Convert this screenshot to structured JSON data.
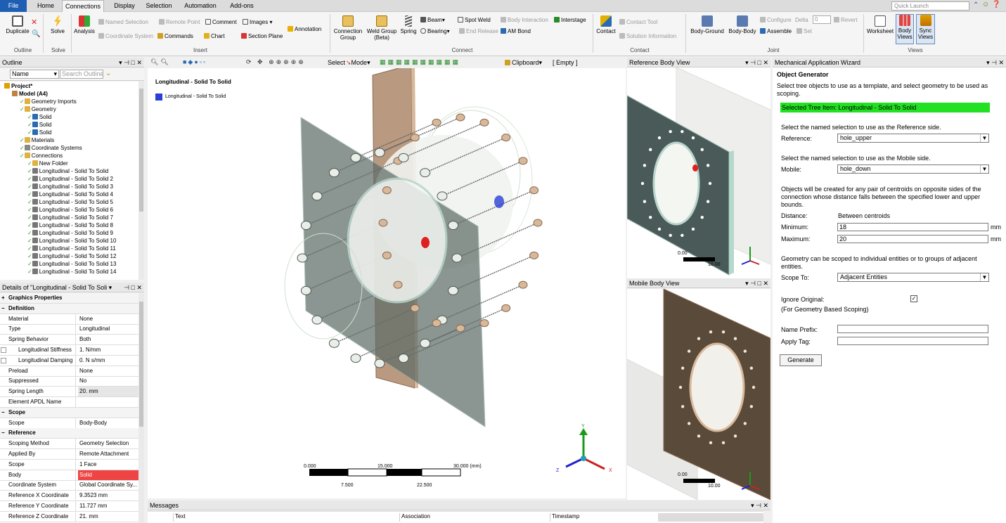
{
  "menu": {
    "tabs": [
      "File",
      "Home",
      "Connections",
      "Display",
      "Selection",
      "Automation",
      "Add-ons"
    ],
    "quick_launch": "Quick Launch"
  },
  "ribbon": {
    "outline": {
      "duplicate": "Duplicate",
      "group": "Outline"
    },
    "solve": {
      "solve": "Solve",
      "group": "Solve"
    },
    "insert": {
      "analysis": "Analysis",
      "named_selection": "Named Selection",
      "remote_point": "Remote Point",
      "comment": "Comment",
      "images": "Images",
      "annotation": "Annotation",
      "coordinate_system": "Coordinate System",
      "commands": "Commands",
      "chart": "Chart",
      "section_plane": "Section Plane",
      "group": "Insert"
    },
    "connect": {
      "connection_group": "Connection Group",
      "weld_group": "Weld Group (Beta)",
      "spring": "Spring",
      "beam": "Beam",
      "spot_weld": "Spot Weld",
      "body_interaction": "Body Interaction",
      "interstage": "Interstage",
      "bearing": "Bearing",
      "end_release": "End Release",
      "am_bond": "AM Bond",
      "group": "Connect"
    },
    "contact": {
      "contact": "Contact",
      "contact_tool": "Contact Tool",
      "solution_information": "Solution Information",
      "group": "Contact"
    },
    "joint": {
      "body_ground": "Body-Ground",
      "body_body": "Body-Body",
      "configure": "Configure",
      "delta": "Delta",
      "delta_value": "0",
      "revert": "Revert",
      "assemble": "Assemble",
      "set": "Set",
      "group": "Joint"
    },
    "views": {
      "worksheet": "Worksheet",
      "body_views": "Body Views",
      "sync_views": "Sync Views",
      "group": "Views"
    }
  },
  "outline": {
    "title": "Outline",
    "name_col": "Name",
    "search_placeholder": "Search Outline",
    "items": [
      {
        "label": "Project*",
        "indent": 0,
        "icon": "project",
        "bold": true
      },
      {
        "label": "Model (A4)",
        "indent": 1,
        "icon": "model",
        "bold": true
      },
      {
        "label": "Geometry Imports",
        "indent": 2,
        "icon": "folder"
      },
      {
        "label": "Geometry",
        "indent": 2,
        "icon": "folder"
      },
      {
        "label": "Solid",
        "indent": 3,
        "icon": "solid"
      },
      {
        "label": "Solid",
        "indent": 3,
        "icon": "solid"
      },
      {
        "label": "Solid",
        "indent": 3,
        "icon": "solid"
      },
      {
        "label": "Materials",
        "indent": 2,
        "icon": "folder"
      },
      {
        "label": "Coordinate Systems",
        "indent": 2,
        "icon": "coord"
      },
      {
        "label": "Connections",
        "indent": 2,
        "icon": "folder"
      },
      {
        "label": "New Folder",
        "indent": 3,
        "icon": "folder"
      },
      {
        "label": "Longitudinal - Solid To Solid",
        "indent": 3,
        "icon": "spring",
        "selected": true
      },
      {
        "label": "Longitudinal - Solid To Solid 2",
        "indent": 3,
        "icon": "spring"
      },
      {
        "label": "Longitudinal - Solid To Solid 3",
        "indent": 3,
        "icon": "spring"
      },
      {
        "label": "Longitudinal - Solid To Solid 4",
        "indent": 3,
        "icon": "spring"
      },
      {
        "label": "Longitudinal - Solid To Solid 5",
        "indent": 3,
        "icon": "spring"
      },
      {
        "label": "Longitudinal - Solid To Solid 6",
        "indent": 3,
        "icon": "spring"
      },
      {
        "label": "Longitudinal - Solid To Solid 7",
        "indent": 3,
        "icon": "spring"
      },
      {
        "label": "Longitudinal - Solid To Solid 8",
        "indent": 3,
        "icon": "spring"
      },
      {
        "label": "Longitudinal - Solid To Solid 9",
        "indent": 3,
        "icon": "spring"
      },
      {
        "label": "Longitudinal - Solid To Solid 10",
        "indent": 3,
        "icon": "spring"
      },
      {
        "label": "Longitudinal - Solid To Solid 11",
        "indent": 3,
        "icon": "spring"
      },
      {
        "label": "Longitudinal - Solid To Solid 12",
        "indent": 3,
        "icon": "spring"
      },
      {
        "label": "Longitudinal - Solid To Solid 13",
        "indent": 3,
        "icon": "spring"
      },
      {
        "label": "Longitudinal - Solid To Solid 14",
        "indent": 3,
        "icon": "spring"
      }
    ]
  },
  "details": {
    "title": "Details of \"Longitudinal - Solid To Soli",
    "rows": [
      {
        "k": "Graphics Properties",
        "hdr": true,
        "sign": "+"
      },
      {
        "k": "Definition",
        "hdr": true,
        "sign": "−"
      },
      {
        "k": "Material",
        "v": "None"
      },
      {
        "k": "Type",
        "v": "Longitudinal"
      },
      {
        "k": "Spring Behavior",
        "v": "Both"
      },
      {
        "k": "Longitudinal Stiffness",
        "v": "1. N/mm",
        "cb": true
      },
      {
        "k": "Longitudinal Damping",
        "v": "0. N s/mm",
        "cb": true
      },
      {
        "k": "Preload",
        "v": "None"
      },
      {
        "k": "Suppressed",
        "v": "No"
      },
      {
        "k": "Spring Length",
        "v": "20. mm",
        "gray": true
      },
      {
        "k": "Element APDL Name",
        "v": ""
      },
      {
        "k": "Scope",
        "hdr": true,
        "sign": "−"
      },
      {
        "k": "Scope",
        "v": "Body-Body"
      },
      {
        "k": "Reference",
        "hdr": true,
        "sign": "−"
      },
      {
        "k": "Scoping Method",
        "v": "Geometry Selection"
      },
      {
        "k": "Applied By",
        "v": "Remote Attachment"
      },
      {
        "k": "Scope",
        "v": "1 Face"
      },
      {
        "k": "Body",
        "v": "Solid",
        "red": true
      },
      {
        "k": "Coordinate System",
        "v": "Global Coordinate Sy..."
      },
      {
        "k": "Reference X Coordinate",
        "v": "9.3523 mm"
      },
      {
        "k": "Reference Y Coordinate",
        "v": "11.727 mm"
      },
      {
        "k": "Reference Z Coordinate",
        "v": "21. mm"
      }
    ]
  },
  "viewport": {
    "toolbar": {
      "select": "Select",
      "mode": "Mode",
      "clipboard": "Clipboard",
      "clipboard_state": "[ Empty ]"
    },
    "title": "Longitudinal - Solid To Solid",
    "legend": "Longitudinal - Solid To Solid",
    "legend_color": "#2a3fd6",
    "scale": {
      "t0": "0.000",
      "t1": "15.000",
      "t2": "30.000 (mm)",
      "b1": "7.500",
      "b2": "22.500"
    },
    "axes": {
      "x": "X",
      "y": "Y",
      "z": "Z"
    }
  },
  "messages": {
    "title": "Messages",
    "cols": [
      "Text",
      "Association",
      "Timestamp"
    ]
  },
  "reference_view": {
    "title": "Reference Body View",
    "scale_l": "0.00",
    "scale_r": "10.00"
  },
  "mobile_view": {
    "title": "Mobile Body View",
    "scale_l": "0.00",
    "scale_r": "10.00"
  },
  "wizard": {
    "title": "Mechanical Application Wizard",
    "heading": "Object Generator",
    "intro": "Select tree objects to use as a template, and select geometry to be used as scoping.",
    "selected_item": "Selected Tree Item: Longitudinal - Solid To Solid",
    "ref_prompt": "Select the named selection to use as the Reference side.",
    "ref_label": "Reference:",
    "ref_value": "hole_upper",
    "mob_prompt": "Select the named selection to use as the Mobile side.",
    "mob_label": "Mobile:",
    "mob_value": "hole_down",
    "objects_text": "Objects will be created for any pair of centroids on opposite sides of the connection whose distance falls between the specified lower and upper bounds.",
    "distance_label": "Distance:",
    "distance_value": "Between centroids",
    "min_label": "Minimum:",
    "min_value": "18",
    "max_label": "Maximum:",
    "max_value": "20",
    "unit": "mm",
    "scope_text": "Geometry can be scoped to individual entities or to groups of adjacent entities.",
    "scope_label": "Scope To:",
    "scope_value": "Adjacent Entities",
    "ignore_label": "Ignore Original:",
    "ignore_note": "(For Geometry Based Scoping)",
    "prefix_label": "Name Prefix:",
    "tag_label": "Apply Tag:",
    "generate": "Generate",
    "highlight_color": "#22e022"
  }
}
